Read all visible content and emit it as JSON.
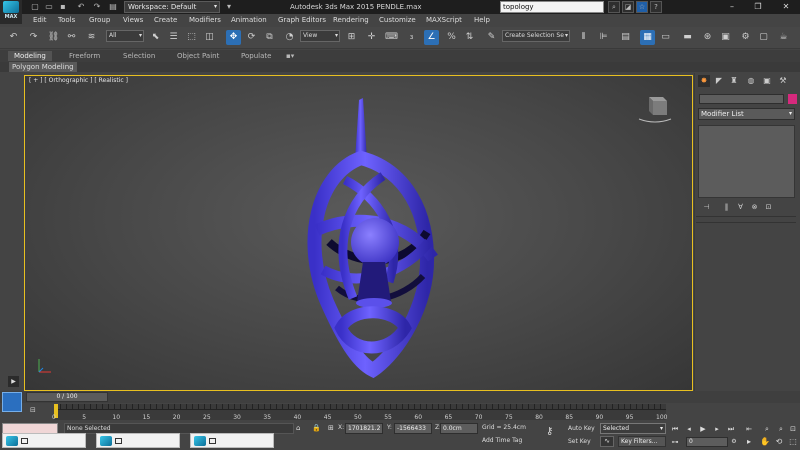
{
  "app": {
    "logo_text": "MAX",
    "title": "Autodesk 3ds Max  2015     PENDLE.max",
    "workspace": "Workspace: Default",
    "search_value": "topology"
  },
  "menu": [
    "Edit",
    "Tools",
    "Group",
    "Views",
    "Create",
    "Modifiers",
    "Animation",
    "Graph Editors",
    "Rendering",
    "Customize",
    "MAXScript",
    "Help"
  ],
  "toolbar": {
    "selection_filter": "All",
    "reference_coord": "View",
    "named_selection": "Create Selection Se"
  },
  "ribbon": {
    "tabs": [
      "Modeling",
      "Freeform",
      "Selection",
      "Object Paint",
      "Populate"
    ],
    "active_tab": "Modeling",
    "panel_label": "Polygon Modeling"
  },
  "viewport": {
    "label": "[ + ] [ Orthographic ] [ Realistic ]",
    "object_color": "#5a4ef0",
    "border_color": "#e8c020"
  },
  "command_panel": {
    "modifier_list_label": "Modifier List",
    "object_color": "#d6297d"
  },
  "timeline": {
    "slider_text": "0 / 100",
    "tick_labels": [
      "0",
      "5",
      "10",
      "15",
      "20",
      "25",
      "30",
      "35",
      "40",
      "45",
      "50",
      "55",
      "60",
      "65",
      "70",
      "75",
      "80",
      "85",
      "90",
      "95",
      "100"
    ]
  },
  "status": {
    "selection_text": "None Selected",
    "x_label": "X:",
    "x_value": "1701821.2",
    "y_label": "Y:",
    "y_value": "-1566433",
    "z_label": "Z:",
    "z_value": "0.0cm",
    "grid": "Grid = 25.4cm",
    "add_time_tag": "Add Time Tag",
    "auto_key": "Auto Key",
    "set_key": "Set Key",
    "key_mode": "Selected",
    "key_filters": "Key Filters...",
    "current_frame": "0"
  }
}
